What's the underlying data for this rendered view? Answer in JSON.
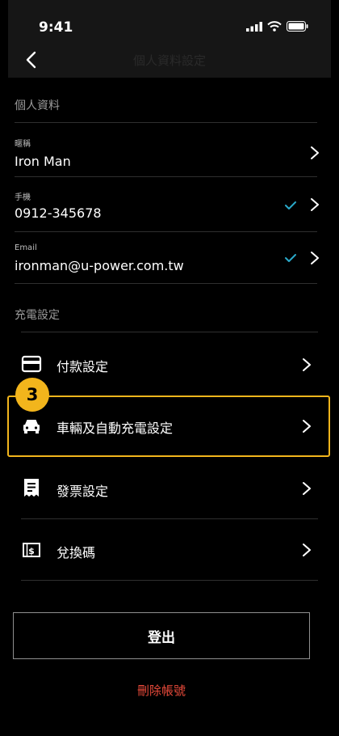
{
  "status_bar": {
    "time": "9:41"
  },
  "nav": {
    "title": "個人資料設定"
  },
  "personal": {
    "section_title": "個人資料",
    "fields": [
      {
        "label": "暱稱",
        "value": "Iron Man",
        "verified": false
      },
      {
        "label": "手機",
        "value": "0912-345678",
        "verified": true
      },
      {
        "label": "Email",
        "value": "ironman@u-power.com.tw",
        "verified": true
      }
    ]
  },
  "charging": {
    "section_title": "充電設定",
    "items": [
      {
        "label": "付款設定",
        "icon": "credit-card-icon"
      },
      {
        "label": "車輛及自動充電設定",
        "icon": "car-icon"
      },
      {
        "label": "發票設定",
        "icon": "receipt-icon"
      },
      {
        "label": "兌換碼",
        "icon": "voucher-icon"
      }
    ]
  },
  "annotation": {
    "step_number": "3",
    "color": "#f2b51c"
  },
  "actions": {
    "logout_label": "登出",
    "delete_label": "刪除帳號"
  },
  "colors": {
    "check": "#2aa9c9",
    "delete": "#e84a3a",
    "highlight": "#f2b51c"
  }
}
